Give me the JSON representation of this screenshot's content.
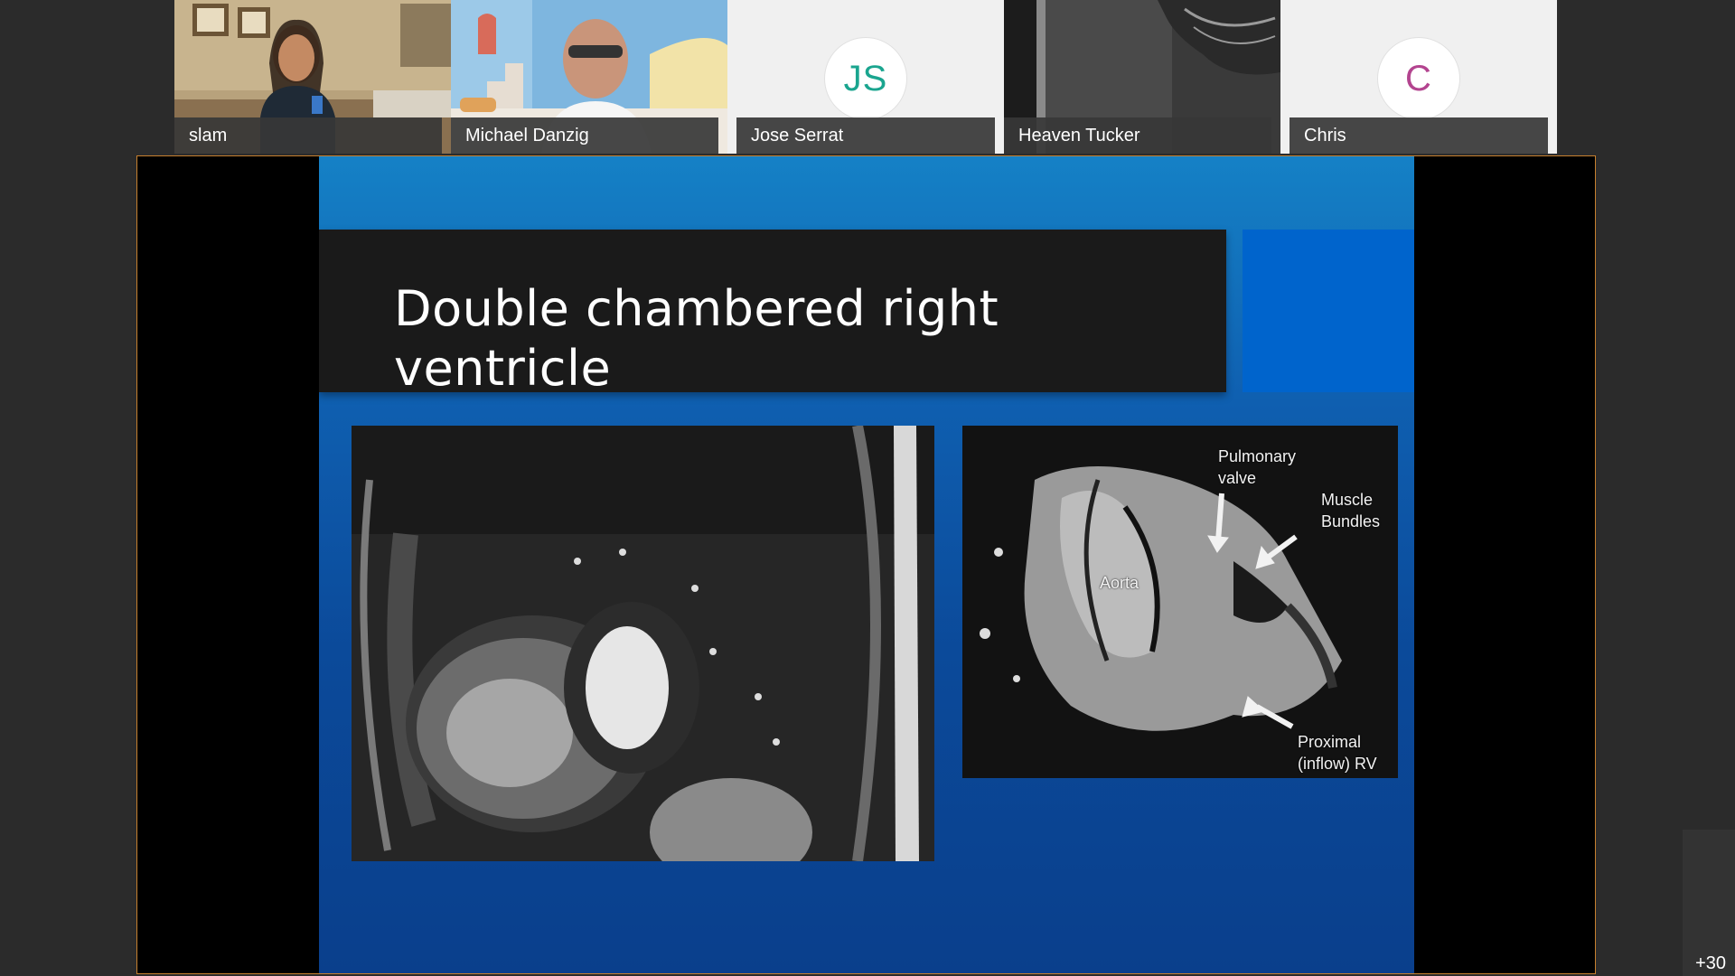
{
  "participants": [
    {
      "name": "slam",
      "type": "video"
    },
    {
      "name": "Michael Danzig",
      "type": "video"
    },
    {
      "name": "Jose Serrat",
      "type": "avatar",
      "initials": "JS",
      "color": "#1aa58f"
    },
    {
      "name": "Heaven Tucker",
      "type": "video"
    },
    {
      "name": "Chris",
      "type": "avatar",
      "initials": "C",
      "color": "#b3448f"
    }
  ],
  "slide": {
    "title": "Double chambered right ventricle",
    "annotations": {
      "pulmonary_valve": "Pulmonary\nvalve",
      "muscle_bundles": "Muscle\nBundles",
      "aorta": "Aorta",
      "proximal_rv": "Proximal\n(inflow) RV"
    }
  },
  "overflow_participants": "+30",
  "colors": {
    "share_border": "#c7802e",
    "slide_accent": "#0064cc",
    "title_bg": "#1a1a1a"
  }
}
